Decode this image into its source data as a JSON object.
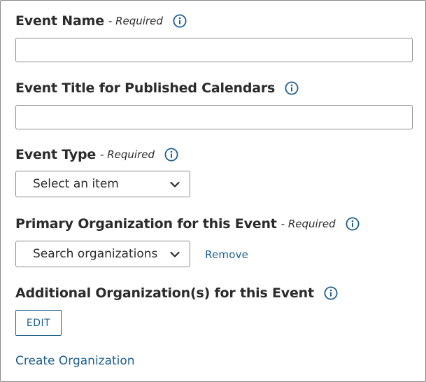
{
  "form": {
    "event_name": {
      "label": "Event Name",
      "required_text": "- Required",
      "value": ""
    },
    "event_title": {
      "label": "Event Title for Published Calendars",
      "value": ""
    },
    "event_type": {
      "label": "Event Type",
      "required_text": "- Required",
      "selected": "Select an item"
    },
    "primary_org": {
      "label": "Primary Organization for this Event",
      "required_text": "- Required",
      "placeholder": "Search organizations",
      "remove_label": "Remove"
    },
    "additional_org": {
      "label": "Additional Organization(s) for this Event",
      "edit_label": "EDIT"
    },
    "create_org_label": "Create Organization"
  },
  "icons": {
    "info": "info-circle-icon",
    "dropdown": "chevron-down-icon"
  },
  "colors": {
    "accent": "#1d5f8f",
    "text": "#2b2b2b",
    "border": "#8c8c8c"
  }
}
